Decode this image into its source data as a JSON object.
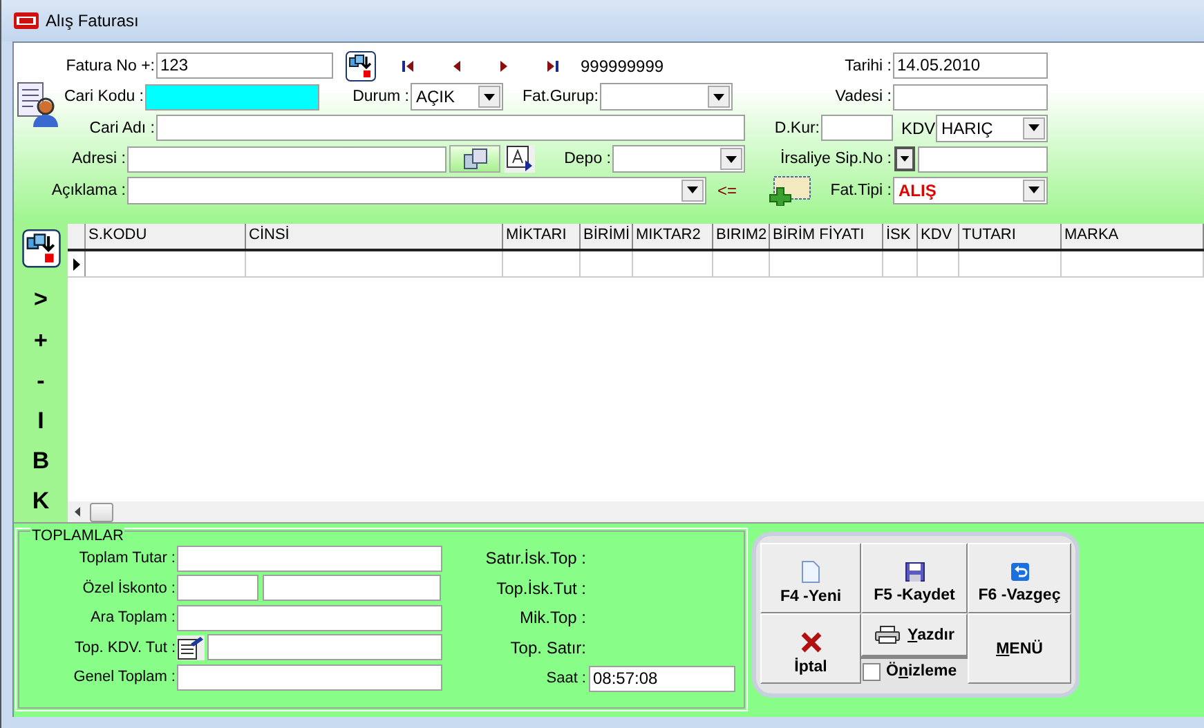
{
  "window": {
    "title": "Alış Faturası"
  },
  "header": {
    "fatura_no": {
      "label": "Fatura No +:",
      "value": "123"
    },
    "nav": [
      {
        "kind": "first"
      },
      {
        "kind": "prev"
      },
      {
        "kind": "next"
      },
      {
        "kind": "last"
      }
    ],
    "record_number": "999999999",
    "cari_kodu": {
      "label": "Cari Kodu :"
    },
    "durum": {
      "label": "Durum :",
      "value": "AÇIK"
    },
    "fat_gurup": {
      "label": "Fat.Gurup:"
    },
    "cari_adi": {
      "label": "Cari Adı :"
    },
    "adresi": {
      "label": "Adresi :"
    },
    "depo": {
      "label": "Depo :"
    },
    "aciklama": {
      "label": "Açıklama :",
      "arrow": "<="
    },
    "tarihi": {
      "label": "Tarihi :",
      "value": "14.05.2010"
    },
    "vadesi": {
      "label": "Vadesi :"
    },
    "d_kur": {
      "label": "D.Kur:"
    },
    "kdv": {
      "label": "KDV",
      "value": "HARIÇ"
    },
    "irsaliye": {
      "label": "İrsaliye Sip.No :"
    },
    "fat_tipi": {
      "label": "Fat.Tipi :",
      "value": "ALIŞ"
    }
  },
  "side_tools": [
    ">",
    "+",
    "-",
    "I",
    "B",
    "K"
  ],
  "table": {
    "columns": [
      "S.KODU",
      "CİNSİ",
      "MİKTARI",
      "BİRİMİ",
      "MIKTAR2",
      "BIRIM2",
      "BİRİM FİYATI",
      "İSK",
      "KDV",
      "TUTARI",
      "MARKA"
    ]
  },
  "totals": {
    "title": "TOPLAMLAR",
    "fields": [
      {
        "label": "Toplam Tutar :",
        "kind": "single"
      },
      {
        "label": "Özel İskonto :",
        "kind": "split"
      },
      {
        "label": "Ara Toplam :",
        "kind": "single"
      },
      {
        "label": "Top. KDV. Tut :",
        "kind": "icon"
      },
      {
        "label": "Genel Toplam :",
        "kind": "single"
      }
    ],
    "summary": [
      "Satır.İsk.Top :",
      "Top.İsk.Tut :",
      "Mik.Top :",
      "Top. Satır:"
    ],
    "saat": {
      "label": "Saat :",
      "value": "08:57:08"
    }
  },
  "buttons": [
    {
      "kind": "new",
      "label": "F4 -Yeni"
    },
    {
      "kind": "save",
      "label": "F5 -Kaydet"
    },
    {
      "kind": "undo",
      "label": "F6 -Vazgeç"
    },
    {
      "kind": "cancel",
      "label": "İptal"
    },
    {
      "kind": "print",
      "key": "Y",
      "after": "azdır"
    },
    {
      "kind": "menu",
      "key": "M",
      "after": "ENÜ"
    }
  ],
  "preview": {
    "before": "Ö",
    "key": "n",
    "after": "izleme",
    "checked": false
  }
}
